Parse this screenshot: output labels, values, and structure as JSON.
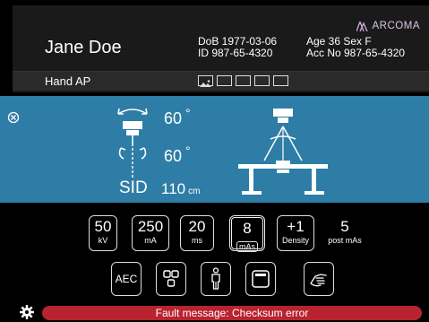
{
  "brand": {
    "name": "ARCOMA"
  },
  "patient": {
    "name": "Jane Doe",
    "dob_line": "DoB 1977-03-06",
    "id_line": "ID 987-65-4320",
    "age_sex_line": "Age 36  Sex F",
    "acc_line": "Acc No 987-65-4320"
  },
  "exam": {
    "name": "Hand AP",
    "thumbnail_count": 5
  },
  "geometry": {
    "tube_tilt": "60",
    "tube_rotation": "60",
    "degree_symbol": "°",
    "sid_label": "SID",
    "sid_value": "110",
    "sid_unit": "cm"
  },
  "params": [
    {
      "value": "50",
      "unit": "kV"
    },
    {
      "value": "250",
      "unit": "mA"
    },
    {
      "value": "20",
      "unit": "ms"
    },
    {
      "value": "8",
      "unit": "mAs",
      "selected": true
    },
    {
      "value": "+1",
      "unit": "Density"
    },
    {
      "value": "5",
      "unit": "post mAs"
    }
  ],
  "tools": {
    "aec_label": "AEC",
    "icons": [
      "aec-button",
      "field-layout-icon",
      "patient-standing-icon",
      "detector-frame-icon",
      "hand-icon"
    ]
  },
  "status": {
    "fault_message": "Fault message: Checksum error"
  },
  "colors": {
    "geometry_bg": "#2e7da6",
    "fault_bg": "#b8232f",
    "header_bg": "#1a1a1a"
  }
}
